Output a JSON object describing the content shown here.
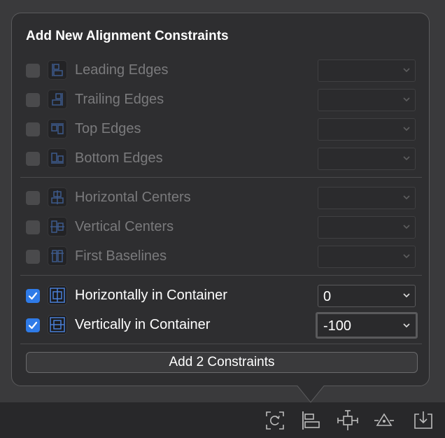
{
  "popover": {
    "title": "Add New Alignment Constraints",
    "rows": [
      {
        "label": "Leading Edges",
        "checked": false,
        "value": "",
        "icon": "leading-edges-icon"
      },
      {
        "label": "Trailing Edges",
        "checked": false,
        "value": "",
        "icon": "trailing-edges-icon"
      },
      {
        "label": "Top Edges",
        "checked": false,
        "value": "",
        "icon": "top-edges-icon"
      },
      {
        "label": "Bottom Edges",
        "checked": false,
        "value": "",
        "icon": "bottom-edges-icon"
      },
      {
        "label": "Horizontal Centers",
        "checked": false,
        "value": "",
        "icon": "horizontal-centers-icon"
      },
      {
        "label": "Vertical Centers",
        "checked": false,
        "value": "",
        "icon": "vertical-centers-icon"
      },
      {
        "label": "First Baselines",
        "checked": false,
        "value": "",
        "icon": "first-baselines-icon"
      },
      {
        "label": "Horizontally in Container",
        "checked": true,
        "value": "0",
        "icon": "horizontally-in-container-icon"
      },
      {
        "label": "Vertically in Container",
        "checked": true,
        "value": "-100",
        "icon": "vertically-in-container-icon"
      }
    ],
    "add_button_label": "Add 2 Constraints"
  },
  "toolbar": {
    "icons": [
      "update-frames-icon",
      "align-icon",
      "add-constraints-icon",
      "resolve-issues-icon",
      "embed-in-icon"
    ]
  },
  "colors": {
    "accent": "#2f7be8",
    "focus_ring": "#2f6db5",
    "icon_blue": "#4a7fd6"
  }
}
